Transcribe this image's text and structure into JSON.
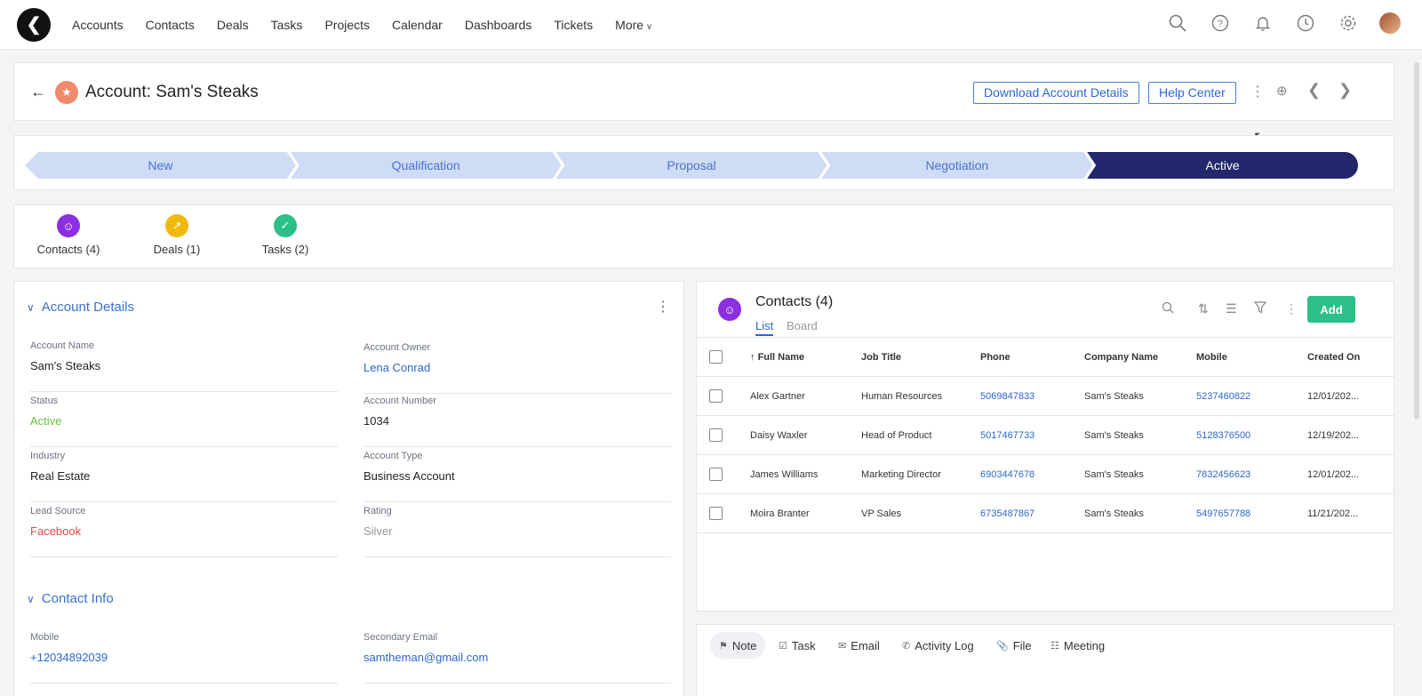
{
  "nav": {
    "links": [
      "Accounts",
      "Contacts",
      "Deals",
      "Tasks",
      "Projects",
      "Calendar",
      "Dashboards",
      "Tickets"
    ],
    "more": "More",
    "icons": [
      "search-icon",
      "help-icon",
      "bell-icon",
      "clock-icon",
      "gear-icon"
    ]
  },
  "header": {
    "title": "Account: Sam's Steaks",
    "download_label": "Download Account Details",
    "help_label": "Help Center"
  },
  "pipeline": {
    "stages": [
      "New",
      "Qualification",
      "Proposal",
      "Negotiation",
      "Active"
    ],
    "active_stage": "Active"
  },
  "related": {
    "tabs": [
      {
        "label": "Contacts (4)",
        "color": "#8b2fe0"
      },
      {
        "label": "Deals (1)",
        "color": "#f0b90b"
      },
      {
        "label": "Tasks (2)",
        "color": "#2cbf88"
      }
    ]
  },
  "details": {
    "section_title": "Account Details",
    "fields": {
      "account_name": {
        "label": "Account Name",
        "value": "Sam's Steaks"
      },
      "account_owner": {
        "label": "Account Owner",
        "value": "Lena Conrad"
      },
      "status": {
        "label": "Status",
        "value": "Active"
      },
      "account_number": {
        "label": "Account Number",
        "value": "1034"
      },
      "industry": {
        "label": "Industry",
        "value": "Real Estate"
      },
      "account_type": {
        "label": "Account Type",
        "value": "Business Account"
      },
      "lead_source": {
        "label": "Lead Source",
        "value": "Facebook"
      },
      "rating": {
        "label": "Rating",
        "value": "Silver"
      }
    },
    "contact_section_title": "Contact Info",
    "contact_fields": {
      "mobile": {
        "label": "Mobile",
        "value": "+12034892039"
      },
      "secondary_email": {
        "label": "Secondary Email",
        "value": "samtheman@gmail.com"
      }
    }
  },
  "contacts": {
    "title": "Contacts (4)",
    "view_tabs": [
      "List",
      "Board"
    ],
    "add_label": "Add",
    "columns": [
      "Full Name",
      "Job Title",
      "Phone",
      "Company Name",
      "Mobile",
      "Created On"
    ],
    "rows": [
      [
        "Alex Gartner",
        "Human Resources",
        "5069847833",
        "Sam's Steaks",
        "5237460822",
        "12/01/202..."
      ],
      [
        "Daisy Waxler",
        "Head of Product",
        "5017467733",
        "Sam's Steaks",
        "5128376500",
        "12/19/202..."
      ],
      [
        "James Williams",
        "Marketing Director",
        "6903447678",
        "Sam's Steaks",
        "7832456623",
        "12/01/202..."
      ],
      [
        "Moira Branter",
        "VP Sales",
        "6735487867",
        "Sam's Steaks",
        "5497657788",
        "11/21/202..."
      ]
    ]
  },
  "activity": {
    "tabs": [
      "Note",
      "Task",
      "Email",
      "Activity Log",
      "File",
      "Meeting"
    ]
  }
}
